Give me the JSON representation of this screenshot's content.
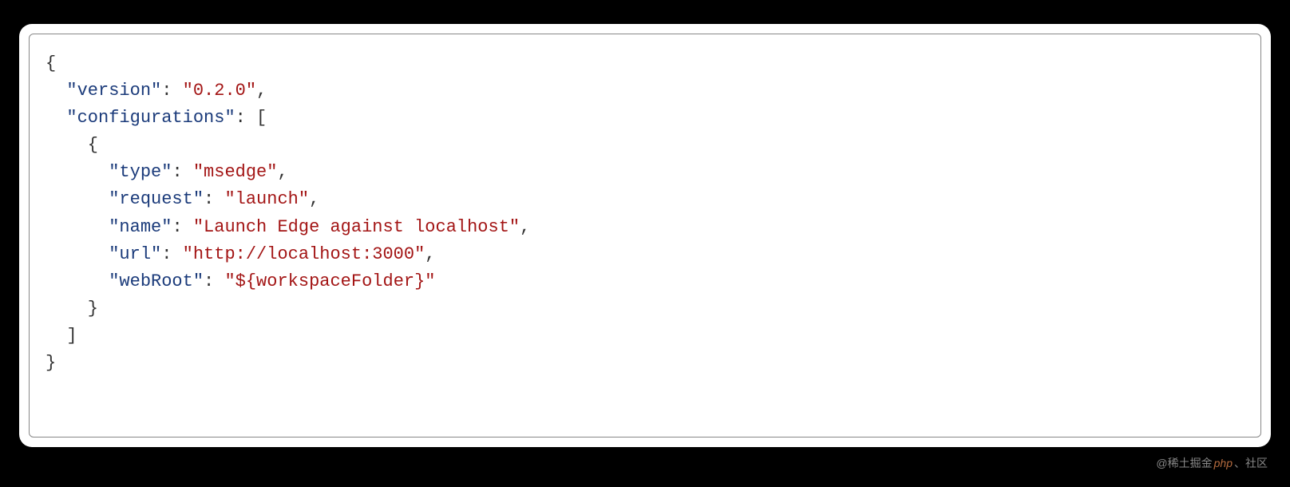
{
  "code": {
    "line1_open": "{",
    "line2_key": "\"version\"",
    "line2_colon": ": ",
    "line2_val": "\"0.2.0\"",
    "line2_comma": ",",
    "line3_key": "\"configurations\"",
    "line3_colon": ": [",
    "line4_open": "    {",
    "line5_indent": "      ",
    "line5_key": "\"type\"",
    "line5_colon": ": ",
    "line5_val": "\"msedge\"",
    "line5_comma": ",",
    "line6_key": "\"request\"",
    "line6_val": "\"launch\"",
    "line7_key": "\"name\"",
    "line7_val": "\"Launch Edge against localhost\"",
    "line8_key": "\"url\"",
    "line8_val": "\"http://localhost:3000\"",
    "line9_key": "\"webRoot\"",
    "line9_val": "\"${workspaceFolder}\"",
    "line10_close": "    }",
    "line11_close": "  ]",
    "line12_close": "}"
  },
  "watermark": {
    "prefix": "@稀土掘金",
    "mid": "php",
    "suffix": "、社区"
  },
  "config_json": {
    "version": "0.2.0",
    "configurations": [
      {
        "type": "msedge",
        "request": "launch",
        "name": "Launch Edge against localhost",
        "url": "http://localhost:3000",
        "webRoot": "${workspaceFolder}"
      }
    ]
  }
}
